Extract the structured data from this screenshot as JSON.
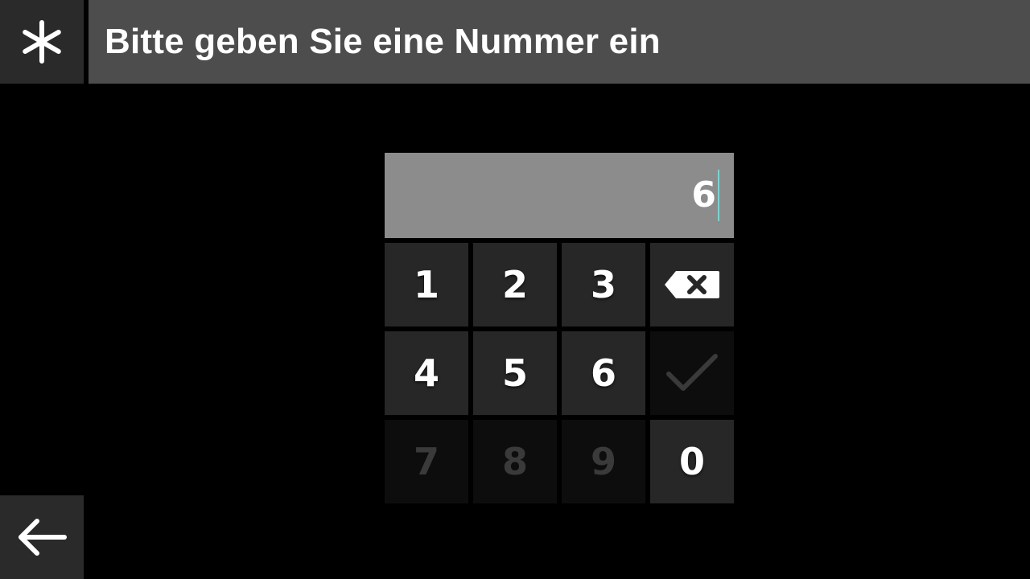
{
  "header": {
    "title": "Bitte geben Sie eine Nummer ein",
    "menu_icon": "asterisk-icon"
  },
  "footer": {
    "back_icon": "arrow-left-icon"
  },
  "input": {
    "value": "6"
  },
  "keypad": {
    "keys": [
      {
        "label": "1",
        "enabled": true
      },
      {
        "label": "2",
        "enabled": true
      },
      {
        "label": "3",
        "enabled": true
      },
      {
        "label": "backspace",
        "icon": "backspace-icon",
        "enabled": true
      },
      {
        "label": "4",
        "enabled": true
      },
      {
        "label": "5",
        "enabled": true
      },
      {
        "label": "6",
        "enabled": true
      },
      {
        "label": "confirm",
        "icon": "checkmark-icon",
        "enabled": false
      },
      {
        "label": "7",
        "enabled": false
      },
      {
        "label": "8",
        "enabled": false
      },
      {
        "label": "9",
        "enabled": false
      },
      {
        "label": "0",
        "enabled": true
      }
    ]
  },
  "colors": {
    "background": "#000000",
    "title_bar": "#4d4d4d",
    "side_button": "#2a2a2a",
    "display": "#8c8c8c",
    "key_enabled": "#272727",
    "key_disabled": "#0d0d0d",
    "cursor": "#7fd3cf"
  }
}
